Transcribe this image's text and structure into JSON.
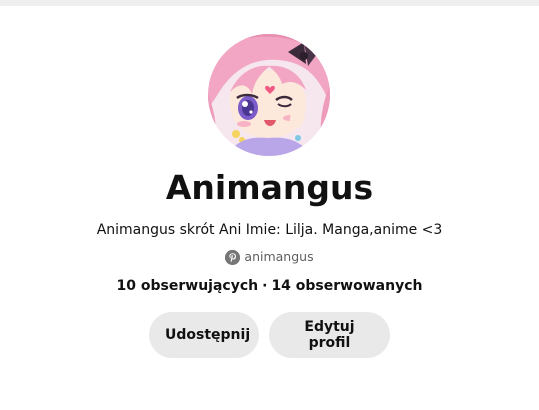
{
  "profile": {
    "display_name": "Animangus",
    "bio": "Animangus skrót Ani Imie: Lilja. Manga,anime <3",
    "handle": "animangus",
    "followers": "10 obserwujących",
    "separator": "·",
    "following": "14 obserwowanych"
  },
  "actions": {
    "share_label": "Udostępnij",
    "edit_label": "Edytuj profil"
  },
  "icons": {
    "handle_icon": "pinterest-icon"
  },
  "colors": {
    "button_bg": "#e9e9e9",
    "text_primary": "#111111",
    "text_secondary": "#5f5f5f",
    "top_strip": "#efefef"
  }
}
